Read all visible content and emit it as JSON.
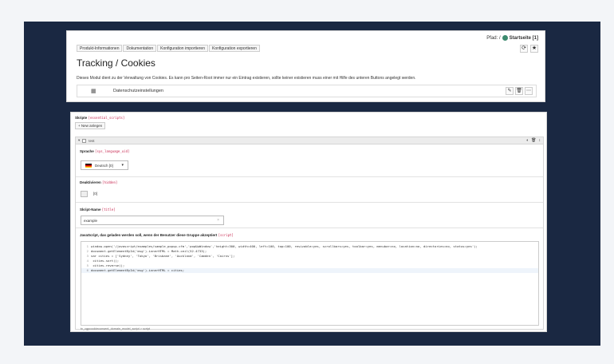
{
  "header": {
    "path_label": "Pfad: /",
    "page_name": "Startseite [1]"
  },
  "tabs": [
    "Produkt-Informationen",
    "Dokumentation",
    "Konfiguration importieren",
    "Konfiguration exportieren"
  ],
  "title": "Tracking / Cookies",
  "description": "Dieses Modul dient zu der Verwaltung von Cookies. Es kann pro Seiten-Root immer nur ein Eintrag existieren, sollte keiner existieren muss einer mit Hilfe des unteren Buttons angelegt werden.",
  "record": {
    "label": "Datenschutzeinstellungen"
  },
  "skripte": {
    "label": "Skripte",
    "field": "[essential_scripts]",
    "new_button": "+ New anlegen",
    "item_label": "test"
  },
  "fields": {
    "sprache": {
      "label": "Sprache",
      "field": "[sys_language_uid]",
      "value": "Deutsch [0]"
    },
    "deaktivieren": {
      "label": "Deaktivieren",
      "field": "[hidden]",
      "value": "[0]"
    },
    "skriptname": {
      "label": "Skript-Name",
      "field": "[title]",
      "value": "example"
    },
    "javascript": {
      "label": "JavaScript, das geladen werden soll, wenn der Benutzer diese Gruppe akzeptiert",
      "field": "[script]"
    }
  },
  "code_lines": [
    {
      "n": "1",
      "text": "window.open('/javascript/examples/sample_popup.cfm','popUpWindow','height=300, width=400, left=100, top=100, resizable=yes, scrollbars=yes, toolbar=yes, menubar=no, location=no, directories=no, status=yes');"
    },
    {
      "n": "2",
      "text": "document.getElementById('msg').innerHTML = Math.ceil(52.4733);"
    },
    {
      "n": "3",
      "text": "var cities = ['Sydney', 'Tokyo', 'Brisbane', 'Auckland', 'Camden', 'Cairns'];"
    },
    {
      "n": "4",
      "text": "    cities.sort();"
    },
    {
      "n": "5",
      "text": "    cities.reverse();"
    },
    {
      "n": "6",
      "text": "document.getElementById('msg').innerHTML = cities;"
    }
  ],
  "editor_footer": "tx_cgpcookieconsent_domain_model_script > script",
  "icons": [
    "globe-icon",
    "reload-icon",
    "star-icon",
    "record-icon",
    "edit-icon",
    "delete-icon",
    "more-icon",
    "visibility-icon",
    "trash-icon",
    "drag-icon",
    "chevron-down-icon",
    "clear-icon"
  ]
}
